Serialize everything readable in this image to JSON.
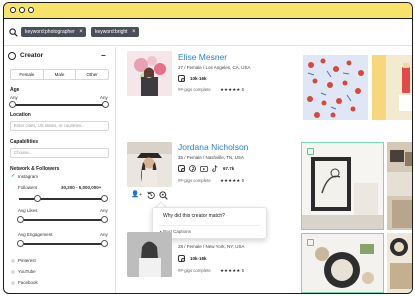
{
  "search": {
    "chips": [
      "keyword:photographer",
      "keyword:bright"
    ]
  },
  "sidebar": {
    "title": "Creator",
    "collapse_symbol": "−",
    "gender_options": [
      "Female",
      "Male",
      "Other"
    ],
    "age": {
      "label": "Age",
      "min_label": "Any",
      "max_label": "Any"
    },
    "location": {
      "label": "Location",
      "placeholder": "Enter cities, US states, or countries..."
    },
    "capabilities": {
      "label": "Capabilities",
      "placeholder": "Choose..."
    },
    "networks": {
      "label": "Network & Followers",
      "instagram_label": "Instagram",
      "followers_label": "Followers",
      "followers_range": "30,200 - 5,000,000+",
      "avg_likes_label": "Avg Likes",
      "avg_likes_max": "Any",
      "avg_engagement_label": "Avg Engagement",
      "avg_engagement_max": "Any",
      "other": [
        "Pinterest",
        "YouTube",
        "Facebook"
      ]
    }
  },
  "creators": [
    {
      "name": "Elise Mesner",
      "meta": "27 / Female / Los Angeles, CA, USA",
      "followers": "10k-16k",
      "gigs": "##-gigs complete",
      "rating": "★★★★★ 5"
    },
    {
      "name": "Jordana Nicholson",
      "meta": "35 / Female / Nashville, TN, USA",
      "followers": "67.7k",
      "gigs": "##-gigs complete",
      "rating": "★★★★★ 5"
    },
    {
      "name": "",
      "meta": "28 / Female / New York, NY, USA",
      "followers": "10k-18k",
      "gigs": "##-gigs complete",
      "rating": "★★★★★ 5"
    }
  ],
  "tooltip": {
    "question": "Why did this creator match?",
    "option": "• Post Captions"
  },
  "colors": {
    "titlebar": "#f7e36a",
    "name_link": "#2f7fc9",
    "chip_bg": "#4a4f5a",
    "selection": "#7ad6b3",
    "check": "#2db37a"
  },
  "icons": {
    "search": "search-icon",
    "instagram": "instagram-icon",
    "pinterest": "pinterest-icon",
    "youtube": "youtube-icon",
    "tiktok": "tiktok-icon",
    "add_user": "add-user-icon",
    "history": "history-icon",
    "match": "match-icon"
  }
}
